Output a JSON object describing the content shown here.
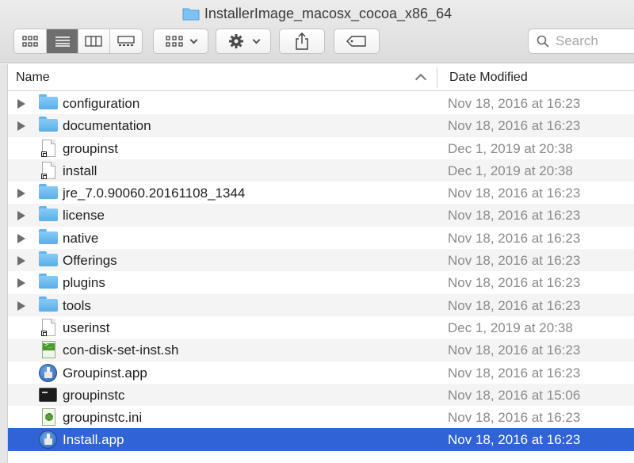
{
  "window": {
    "title": "InstallerImage_macosx_cocoa_x86_64"
  },
  "toolbar": {
    "view_buttons": [
      "icon-view",
      "list-view",
      "column-view",
      "gallery-view"
    ],
    "active_view": "list-view",
    "group_button": "group-icon",
    "action_button": "gear-icon",
    "share_button": "share-icon",
    "tag_button": "tag-icon"
  },
  "search": {
    "placeholder": "Search"
  },
  "columns": {
    "name": "Name",
    "date_modified": "Date Modified"
  },
  "files": [
    {
      "name": "configuration",
      "kind": "folder",
      "date": "Nov 18, 2016 at 16:23"
    },
    {
      "name": "documentation",
      "kind": "folder",
      "date": "Nov 18, 2016 at 16:23"
    },
    {
      "name": "groupinst",
      "kind": "alias",
      "date": "Dec 1, 2019 at 20:38"
    },
    {
      "name": "install",
      "kind": "alias",
      "date": "Dec 1, 2019 at 20:38"
    },
    {
      "name": "jre_7.0.90060.20161108_1344",
      "kind": "folder",
      "date": "Nov 18, 2016 at 16:23"
    },
    {
      "name": "license",
      "kind": "folder",
      "date": "Nov 18, 2016 at 16:23"
    },
    {
      "name": "native",
      "kind": "folder",
      "date": "Nov 18, 2016 at 16:23"
    },
    {
      "name": "Offerings",
      "kind": "folder",
      "date": "Nov 18, 2016 at 16:23"
    },
    {
      "name": "plugins",
      "kind": "folder",
      "date": "Nov 18, 2016 at 16:23"
    },
    {
      "name": "tools",
      "kind": "folder",
      "date": "Nov 18, 2016 at 16:23"
    },
    {
      "name": "userinst",
      "kind": "alias",
      "date": "Dec 1, 2019 at 20:38"
    },
    {
      "name": "con-disk-set-inst.sh",
      "kind": "script",
      "date": "Nov 18, 2016 at 16:23"
    },
    {
      "name": "Groupinst.app",
      "kind": "app",
      "date": "Nov 18, 2016 at 16:23"
    },
    {
      "name": "groupinstc",
      "kind": "terminal",
      "date": "Nov 18, 2016 at 15:06"
    },
    {
      "name": "groupinstc.ini",
      "kind": "ini",
      "date": "Nov 18, 2016 at 16:23"
    },
    {
      "name": "Install.app",
      "kind": "app",
      "date": "Nov 18, 2016 at 16:23",
      "selected": true
    }
  ],
  "colors": {
    "selection": "#2f63d6",
    "folder": "#6fbdf2",
    "date_text": "#8a8a8a"
  }
}
